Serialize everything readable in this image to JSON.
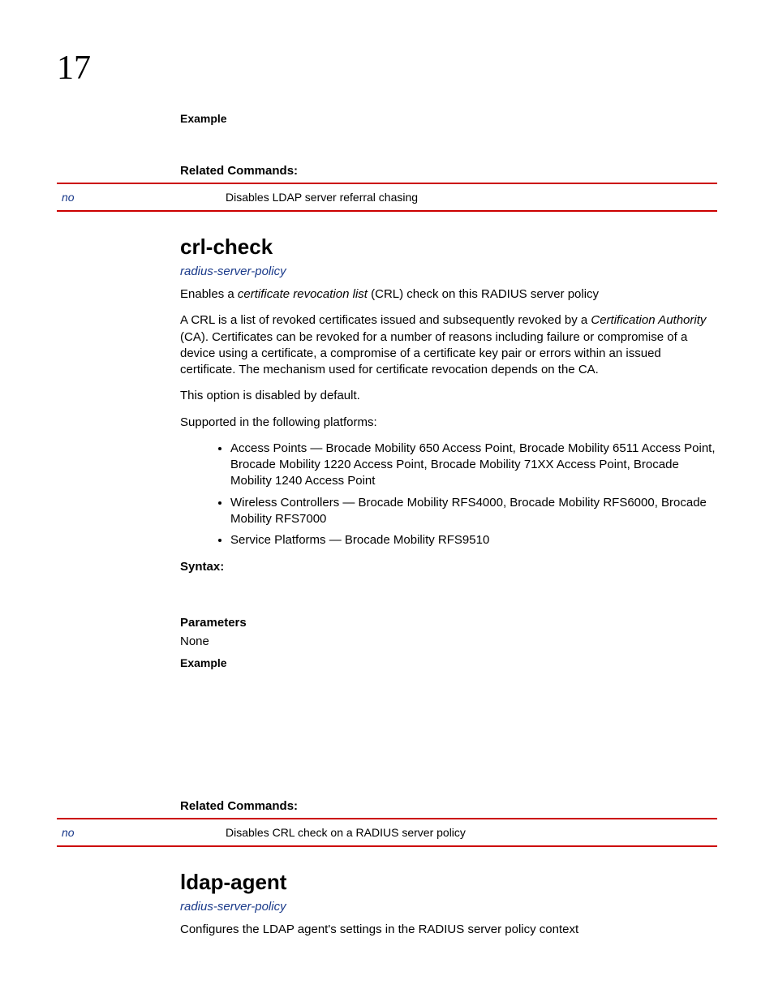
{
  "chapter": "17",
  "section1": {
    "example_label": "Example",
    "related_label": "Related Commands:",
    "related_row": {
      "cmd": "no",
      "desc": "Disables LDAP server referral chasing"
    }
  },
  "crl": {
    "heading": "crl-check",
    "policy_link": "radius-server-policy",
    "intro_pre": "Enables a ",
    "intro_italic": "certificate revocation list",
    "intro_post": " (CRL) check on this RADIUS server policy",
    "desc_pre": "A CRL is a list of revoked certificates issued and subsequently revoked by a ",
    "desc_italic": "Certification Authority",
    "desc_post": " (CA). Certificates can be revoked for a number of reasons including failure or compromise of a device using a certificate, a compromise of a certificate key pair or errors within an issued certificate. The mechanism used for certificate revocation depends on the CA.",
    "disabled_note": "This option is disabled by default.",
    "supported_label": "Supported in the following platforms:",
    "platforms": [
      "Access Points — Brocade Mobility 650 Access Point, Brocade Mobility 6511 Access Point, Brocade Mobility 1220 Access Point, Brocade Mobility 71XX Access Point, Brocade Mobility 1240 Access Point",
      "Wireless Controllers — Brocade Mobility RFS4000, Brocade Mobility RFS6000, Brocade Mobility RFS7000",
      "Service Platforms — Brocade Mobility RFS9510"
    ],
    "syntax_label": "Syntax:",
    "parameters_label": "Parameters",
    "parameters_value": "None",
    "example_label": "Example",
    "related_label": "Related Commands:",
    "related_row": {
      "cmd": "no",
      "desc": "Disables CRL check on a RADIUS server policy"
    }
  },
  "ldap": {
    "heading": "ldap-agent",
    "policy_link": "radius-server-policy",
    "desc": "Configures the LDAP agent's settings in the RADIUS server policy context"
  }
}
